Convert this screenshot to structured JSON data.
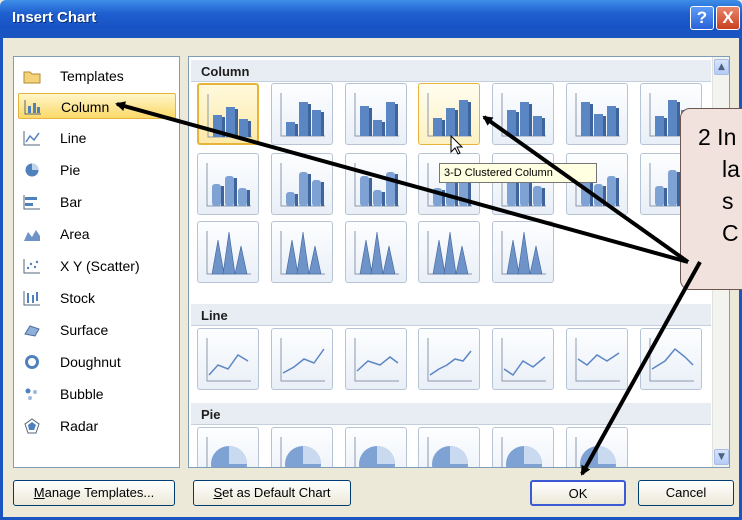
{
  "window": {
    "title": "Insert Chart",
    "help_glyph": "?",
    "close_glyph": "X"
  },
  "sidebar": {
    "items": [
      {
        "label": "Templates",
        "icon": "folder-icon"
      },
      {
        "label": "Column",
        "icon": "column-chart-icon",
        "selected": true
      },
      {
        "label": "Line",
        "icon": "line-chart-icon"
      },
      {
        "label": "Pie",
        "icon": "pie-chart-icon"
      },
      {
        "label": "Bar",
        "icon": "bar-chart-icon"
      },
      {
        "label": "Area",
        "icon": "area-chart-icon"
      },
      {
        "label": "X Y (Scatter)",
        "icon": "scatter-chart-icon"
      },
      {
        "label": "Stock",
        "icon": "stock-chart-icon"
      },
      {
        "label": "Surface",
        "icon": "surface-chart-icon"
      },
      {
        "label": "Doughnut",
        "icon": "doughnut-chart-icon"
      },
      {
        "label": "Bubble",
        "icon": "bubble-chart-icon"
      },
      {
        "label": "Radar",
        "icon": "radar-chart-icon"
      }
    ]
  },
  "gallery": {
    "sections": [
      {
        "name": "Column"
      },
      {
        "name": "Line"
      },
      {
        "name": "Pie"
      }
    ],
    "tooltip": "3-D Clustered Column"
  },
  "buttons": {
    "manage_templates": {
      "underlined": "M",
      "rest": "anage Templates..."
    },
    "set_default": {
      "underlined": "S",
      "rest": "et as Default Chart"
    },
    "ok": "OK",
    "cancel": "Cancel"
  },
  "callout": {
    "lines": [
      "2 In",
      "la",
      "s",
      "C"
    ]
  },
  "colors": {
    "title_bar": "#1753c4",
    "selection": "#fbd969",
    "callout_fill": "#f2e2dd"
  }
}
